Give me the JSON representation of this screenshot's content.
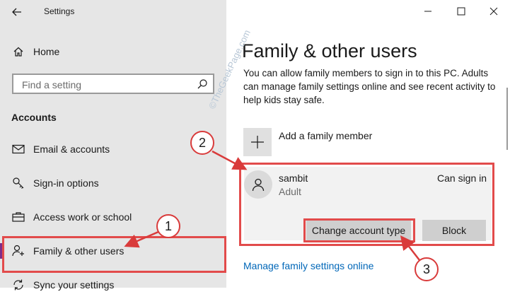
{
  "window": {
    "title": "Settings"
  },
  "sidebar": {
    "home_label": "Home",
    "search_placeholder": "Find a setting",
    "section_heading": "Accounts",
    "items": [
      {
        "label": "Email & accounts",
        "icon": "mail-icon"
      },
      {
        "label": "Sign-in options",
        "icon": "key-icon"
      },
      {
        "label": "Access work or school",
        "icon": "briefcase-icon"
      },
      {
        "label": "Family & other users",
        "icon": "add-person-icon",
        "active": true
      },
      {
        "label": "Sync your settings",
        "icon": "sync-icon"
      }
    ]
  },
  "main": {
    "title": "Family & other users",
    "description": "You can allow family members to sign in to this PC. Adults can manage family settings online and see recent activity to help kids stay safe.",
    "add_member_label": "Add a family member",
    "user": {
      "name": "sambit",
      "role": "Adult",
      "status": "Can sign in"
    },
    "buttons": {
      "change_account_type": "Change account type",
      "block": "Block"
    },
    "manage_link": "Manage family settings online"
  },
  "annotations": {
    "callout_1": "1",
    "callout_2": "2",
    "callout_3": "3",
    "color": "#e24b4b"
  },
  "watermark": "©TheGeekPage.com",
  "colors": {
    "sidebar_bg": "#e6e6e6",
    "accent": "#7d2c8a",
    "link": "#0067b8",
    "button_bg": "#cfcfcf"
  }
}
